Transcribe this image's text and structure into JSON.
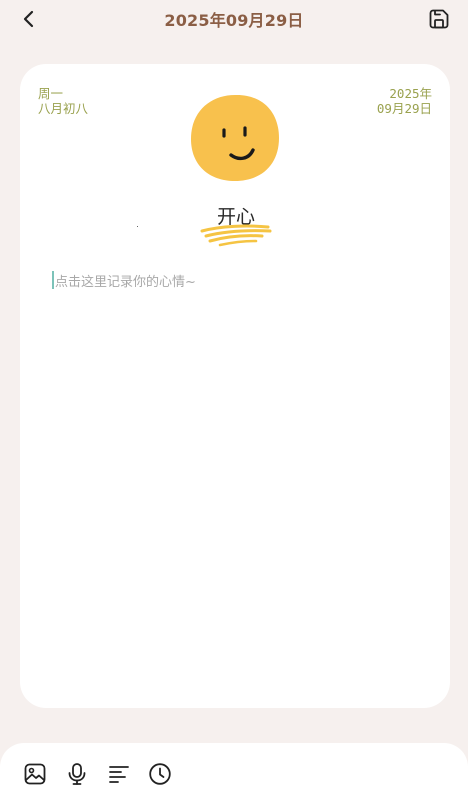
{
  "header": {
    "title": "2025年09月29日",
    "back_icon": "chevron-left-icon",
    "save_icon": "save-icon"
  },
  "card": {
    "weekday": "周一",
    "lunar": "八月初八",
    "year": "2025年",
    "month_day": "09月29日",
    "mood": {
      "label": "开心",
      "face_color": "#f8c14d",
      "scribble_color": "#f5c443"
    },
    "note": {
      "placeholder": "点击这里记录你的心情~"
    }
  },
  "toolbar": {
    "items": [
      {
        "icon": "image-icon"
      },
      {
        "icon": "microphone-icon"
      },
      {
        "icon": "text-align-icon"
      },
      {
        "icon": "clock-icon"
      }
    ]
  },
  "colors": {
    "background": "#f6f0ee",
    "title": "#8b5e45",
    "date_text": "#9aa24f",
    "caret": "#7cc3b9"
  }
}
